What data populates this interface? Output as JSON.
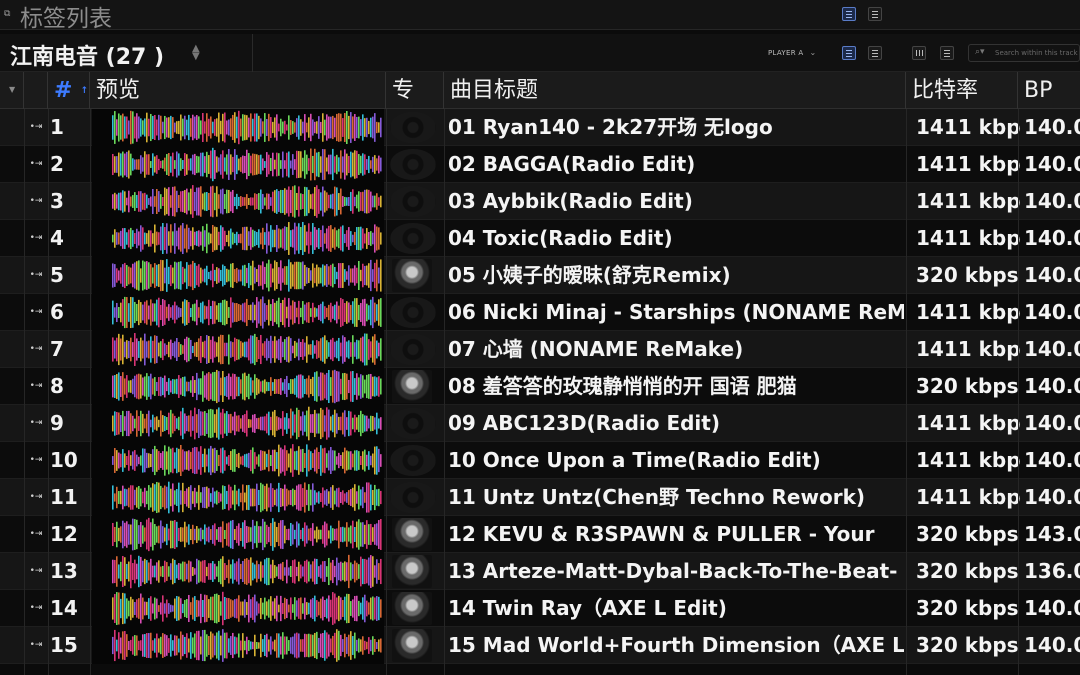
{
  "window": {
    "title": "标签列表",
    "app_icon": "tag-list-icon"
  },
  "playlist": {
    "title": "江南电音 (27 )",
    "player_selector": "PLAYER A",
    "search": {
      "placeholder": "Search within this track list",
      "value": ""
    }
  },
  "columns": {
    "number": "#",
    "preview": "预览",
    "artwork": "专",
    "title": "曲目标题",
    "bitrate": "比特率",
    "bpm": "BP"
  },
  "tracks": [
    {
      "no": "1",
      "title": "01 Ryan140 - 2k27开场 无logo",
      "bitrate": "1411 kbp",
      "bpm": "140.0",
      "art": "disc",
      "wave": "wave-a"
    },
    {
      "no": "2",
      "title": "02 BAGGA(Radio Edit)",
      "bitrate": "1411 kbp",
      "bpm": "140.0",
      "art": "disc",
      "wave": "wave-b"
    },
    {
      "no": "3",
      "title": "03 Aybbik(Radio Edit)",
      "bitrate": "1411 kbp",
      "bpm": "140.0",
      "art": "disc",
      "wave": "wave-b"
    },
    {
      "no": "4",
      "title": "04 Toxic(Radio Edit)",
      "bitrate": "1411 kbp",
      "bpm": "140.0",
      "art": "disc",
      "wave": "wave-b"
    },
    {
      "no": "5",
      "title": "05 小姨子的暧昧(舒克Remix)",
      "bitrate": "320 kbps",
      "bpm": "140.0",
      "art": "photo",
      "wave": "wave-c"
    },
    {
      "no": "6",
      "title": "06 Nicki Minaj - Starships (NONAME ReM",
      "bitrate": "1411 kbp",
      "bpm": "140.0",
      "art": "disc",
      "wave": "wave-d"
    },
    {
      "no": "7",
      "title": "07 心墙 (NONAME ReMake)",
      "bitrate": "1411 kbp",
      "bpm": "140.0",
      "art": "disc",
      "wave": "wave-e"
    },
    {
      "no": "8",
      "title": "08 羞答答的玫瑰静悄悄的开 国语 肥猫",
      "bitrate": "320 kbps",
      "bpm": "140.0",
      "art": "photo",
      "wave": "wave-c"
    },
    {
      "no": "9",
      "title": "09 ABC123D(Radio Edit)",
      "bitrate": "1411 kbp",
      "bpm": "140.0",
      "art": "disc",
      "wave": "wave-b"
    },
    {
      "no": "10",
      "title": "10 Once Upon a Time(Radio Edit)",
      "bitrate": "1411 kbp",
      "bpm": "140.0",
      "art": "disc",
      "wave": "wave-f"
    },
    {
      "no": "11",
      "title": "11 Untz Untz(Chen野 Techno Rework)",
      "bitrate": "1411 kbp",
      "bpm": "140.0",
      "art": "disc",
      "wave": "wave-a"
    },
    {
      "no": "12",
      "title": "12 KEVU & R3SPAWN & PULLER - Your",
      "bitrate": "320 kbps",
      "bpm": "143.0",
      "art": "photo",
      "wave": "wave-g"
    },
    {
      "no": "13",
      "title": "13 Arteze-Matt-Dybal-Back-To-The-Beat-",
      "bitrate": "320 kbps",
      "bpm": "136.0",
      "art": "photo",
      "wave": "wave-e"
    },
    {
      "no": "14",
      "title": "14 Twin Ray（AXE L Edit)",
      "bitrate": "320 kbps",
      "bpm": "140.0",
      "art": "photo",
      "wave": "wave-c"
    },
    {
      "no": "15",
      "title": "15 Mad World+Fourth Dimension（AXE L",
      "bitrate": "320 kbps",
      "bpm": "140.0",
      "art": "photo",
      "wave": "wave-g"
    }
  ],
  "colors": {
    "accent_blue": "#3d7bff",
    "waveform_palette": [
      "#ff3d8b",
      "#ff7a3d",
      "#3de0ff",
      "#9c6bff",
      "#ffd23d",
      "#7dff6b",
      "#ff5cd6"
    ]
  },
  "icons": [
    "tag-list-icon",
    "view-list-icon",
    "view-compact-icon",
    "sort-caret-icon",
    "chevron-down-icon",
    "search-icon",
    "tag-icon",
    "sort-asc-icon"
  ]
}
